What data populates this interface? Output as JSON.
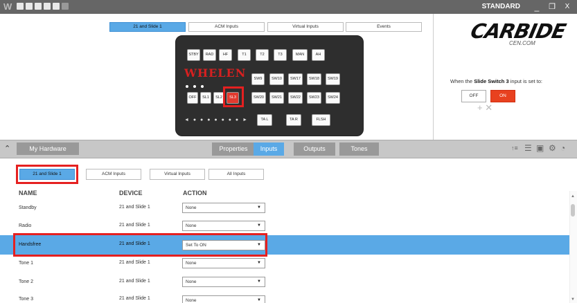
{
  "titlebar": {
    "app_icon": "W",
    "mode": "STANDARD",
    "minimize": "_",
    "restore": "❐",
    "close": "X"
  },
  "device_tabs": [
    {
      "label": "21 and Slide 1",
      "active": true
    },
    {
      "label": "ACM Inputs",
      "active": false
    },
    {
      "label": "Virtual Inputs",
      "active": false
    },
    {
      "label": "Events",
      "active": false
    }
  ],
  "keypad": {
    "row1": [
      "STBY",
      "RAD",
      "HF",
      "T1",
      "T2",
      "T3",
      "MAN",
      "AH"
    ],
    "brand": "WHELEN",
    "row2": [
      "SW9",
      "SW10",
      "SW17",
      "SW18",
      "SW19"
    ],
    "slide": [
      "OFF",
      "SL1",
      "SL2",
      "SL3"
    ],
    "row3": [
      "SW20",
      "SW21",
      "SW22",
      "SW23",
      "SW24"
    ],
    "bottom": [
      "TA L",
      "TA R",
      "FLSH"
    ],
    "arrows": "◄ ● ● ● ● ● ● ● ►"
  },
  "brand": {
    "logo": "CARBIDE",
    "sub": "CEN.COM"
  },
  "switch": {
    "prefix": "When the",
    "name": "Slide Switch 3",
    "suffix": "input is set to:",
    "off": "OFF",
    "on": "ON",
    "add_remove": "+ ✕"
  },
  "toolbar": {
    "collapse": "⌃",
    "my_hardware": "My Hardware",
    "tabs": [
      "Properties",
      "Inputs",
      "Outputs",
      "Tones"
    ],
    "active": "Inputs"
  },
  "filter_tabs": [
    "21 and Slide 1",
    "ACM Inputs",
    "Virtual Inputs",
    "All Inputs"
  ],
  "columns": {
    "name": "NAME",
    "device": "DEVICE",
    "action": "ACTION"
  },
  "rows": [
    {
      "name": "Standby",
      "device": "21 and Slide 1",
      "action": "None"
    },
    {
      "name": "Radio",
      "device": "21 and Slide 1",
      "action": "None"
    },
    {
      "name": "Handsfree",
      "device": "21 and Slide 1",
      "action": "Set To ON",
      "selected": true
    },
    {
      "name": "Tone 1",
      "device": "21 and Slide 1",
      "action": "None"
    },
    {
      "name": "Tone 2",
      "device": "21 and Slide 1",
      "action": "None"
    },
    {
      "name": "Tone 3",
      "device": "21 and Slide 1",
      "action": "None"
    }
  ],
  "colors": {
    "accent": "#5aa9e6",
    "highlight": "#e52020",
    "on": "#e8411f"
  }
}
